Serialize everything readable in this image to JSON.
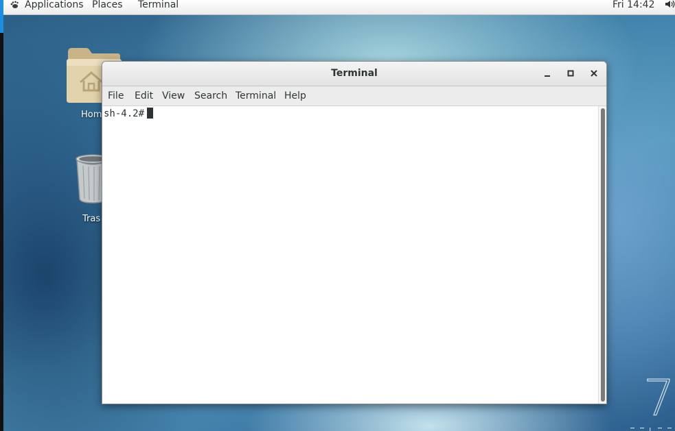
{
  "top_panel": {
    "applications": "Applications",
    "places": "Places",
    "active_app": "Terminal",
    "clock": "Fri 14:42",
    "apps_icon": "gnome-foot-icon",
    "volume_icon": "speaker-icon"
  },
  "desktop": {
    "icons": [
      {
        "label": "Hom",
        "icon": "home-folder-icon"
      },
      {
        "label": "Tras",
        "icon": "trash-icon"
      }
    ],
    "logo_text": "7"
  },
  "terminal_window": {
    "title": "Terminal",
    "controls": {
      "minimize_icon": "minimize-icon",
      "maximize_icon": "maximize-icon",
      "close_icon": "close-icon"
    },
    "menu": [
      "File",
      "Edit",
      "View",
      "Search",
      "Terminal",
      "Help"
    ],
    "prompt": "sh-4.2#"
  },
  "colors": {
    "panel_bg": "#ececec",
    "accent": "#1c8fe0",
    "text": "#2e3436"
  }
}
